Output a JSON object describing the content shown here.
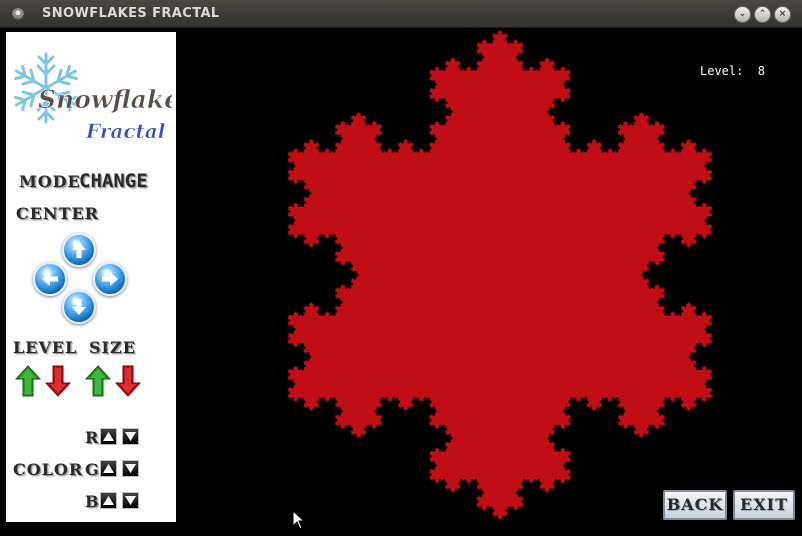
{
  "window": {
    "title": "SNOWFLAKES FRACTAL"
  },
  "logo": {
    "line1": "Snowflakes",
    "line2": "Fractal"
  },
  "panel": {
    "mode_label": "MODE",
    "mode_value": "CHANGE",
    "center_label": "CENTER",
    "level_label": "LEVEL",
    "size_label": "SIZE",
    "color_label": "COLOR",
    "r_label": "R",
    "g_label": "G",
    "b_label": "B"
  },
  "canvas": {
    "level_text": "Level:  8",
    "level": 8,
    "fractal_color": "#c10e14"
  },
  "buttons": {
    "back": "BACK",
    "exit": "EXIT"
  },
  "colors": {
    "arrow_up": "#1f9a1f",
    "arrow_down": "#c40d12",
    "orb_blue": "#2c8fe0"
  }
}
